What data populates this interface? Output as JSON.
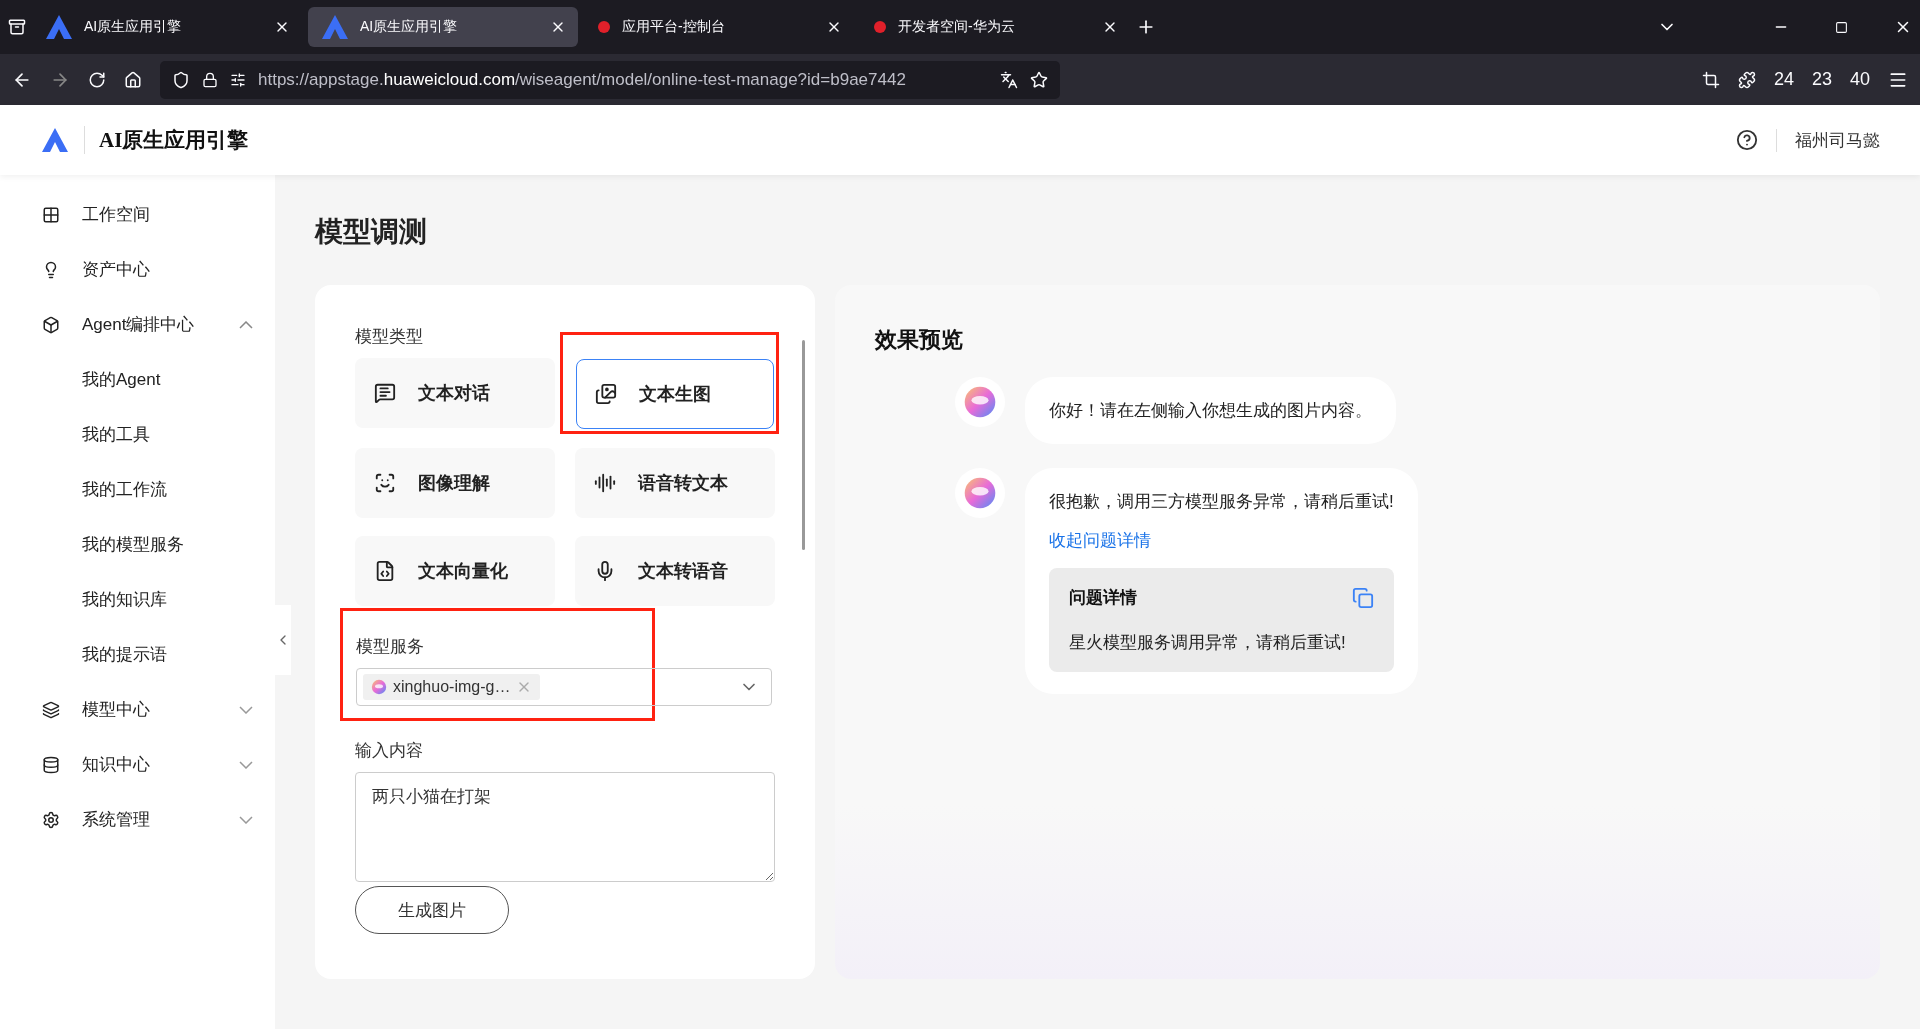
{
  "browser": {
    "tabs": [
      {
        "title": "AI原生应用引擎",
        "kind": "app",
        "selected": false
      },
      {
        "title": "AI原生应用引擎",
        "kind": "app",
        "selected": true
      },
      {
        "title": "应用平台-控制台",
        "kind": "huawei",
        "selected": false
      },
      {
        "title": "开发者空间-华为云",
        "kind": "huawei",
        "selected": false
      }
    ],
    "url_prefix": "https://appstage.",
    "url_domain": "huaweicloud.com",
    "url_path": "/wiseagent/model/online-test-manage?id=b9ae7442",
    "extension_counts": [
      "24",
      "23",
      "40"
    ]
  },
  "header": {
    "title": "AI原生应用引擎",
    "user": "福州司马懿"
  },
  "sidebar": {
    "items": [
      {
        "label": "工作空间"
      },
      {
        "label": "资产中心"
      },
      {
        "label": "Agent编排中心",
        "expanded": true,
        "children": [
          {
            "label": "我的Agent"
          },
          {
            "label": "我的工具"
          },
          {
            "label": "我的工作流"
          },
          {
            "label": "我的模型服务"
          },
          {
            "label": "我的知识库"
          },
          {
            "label": "我的提示语"
          }
        ]
      },
      {
        "label": "模型中心",
        "expanded": false
      },
      {
        "label": "知识中心",
        "expanded": false
      },
      {
        "label": "系统管理",
        "expanded": false
      }
    ]
  },
  "page_title": "模型调测",
  "form": {
    "model_type_label": "模型类型",
    "model_types": [
      {
        "label": "文本对话",
        "selected": false,
        "highlighted": false
      },
      {
        "label": "文本生图",
        "selected": true,
        "highlighted": true
      },
      {
        "label": "图像理解",
        "selected": false,
        "highlighted": false
      },
      {
        "label": "语音转文本",
        "selected": false,
        "highlighted": false
      },
      {
        "label": "文本向量化",
        "selected": false,
        "highlighted": false
      },
      {
        "label": "文本转语音",
        "selected": false,
        "highlighted": false
      }
    ],
    "service_label": "模型服务",
    "service_highlighted": true,
    "service_tag": "xinghuo-img-g…",
    "input_label": "输入内容",
    "input_value": "两只小猫在打架",
    "submit": "生成图片"
  },
  "preview": {
    "title": "效果预览",
    "messages": [
      {
        "kind": "plain",
        "text": "你好！请在左侧输入你想生成的图片内容。"
      },
      {
        "kind": "error",
        "text": "很抱歉，调用三方模型服务异常，请稍后重试!",
        "link": "收起问题详情",
        "detail_title": "问题详情",
        "detail_text": "星火模型服务调用异常，请稍后重试!"
      }
    ]
  }
}
